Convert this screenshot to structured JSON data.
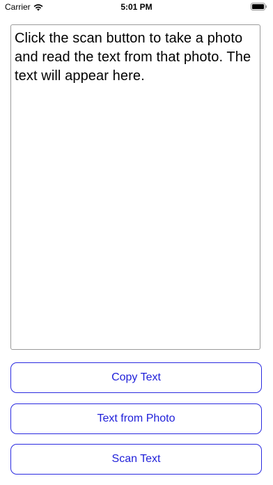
{
  "status_bar": {
    "carrier": "Carrier",
    "time": "5:01 PM",
    "wifi_icon": "wifi-icon",
    "battery_icon": "battery-icon"
  },
  "main": {
    "text_view_content": "Click the scan button to take a photo and read the text from that photo.  The text will appear here."
  },
  "buttons": {
    "copy_text": "Copy Text",
    "text_from_photo": "Text from Photo",
    "scan_text": "Scan Text"
  },
  "colors": {
    "accent": "#1f1fd9",
    "text_view_border": "#9a9a9a"
  }
}
